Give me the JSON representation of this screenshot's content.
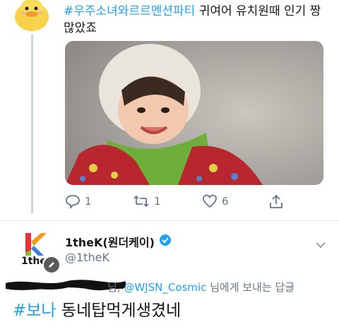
{
  "tweet": {
    "hashtag": "#우주소녀와르르멘션파티",
    "text_line1_rest": " 귀여어 유치원때 인기 짱",
    "text_line2": "많았죠"
  },
  "actions": {
    "reply_count": "1",
    "retweet_count": "1",
    "like_count": "6"
  },
  "reply_account": {
    "name": "1theK(원더케이)",
    "handle": "@1theK",
    "logo_text": "1the"
  },
  "reply_context": {
    "suffix_nim": "님, ",
    "mention": "@WJSN_Cosmic",
    "rest": " 님에게 보내는 답글"
  },
  "reply_body": {
    "hashtag": "#보나",
    "text": " 동네탑먹게생겼네"
  },
  "colors": {
    "link": "#1da1f2",
    "muted": "#657786",
    "verified": "#1da1f2"
  }
}
